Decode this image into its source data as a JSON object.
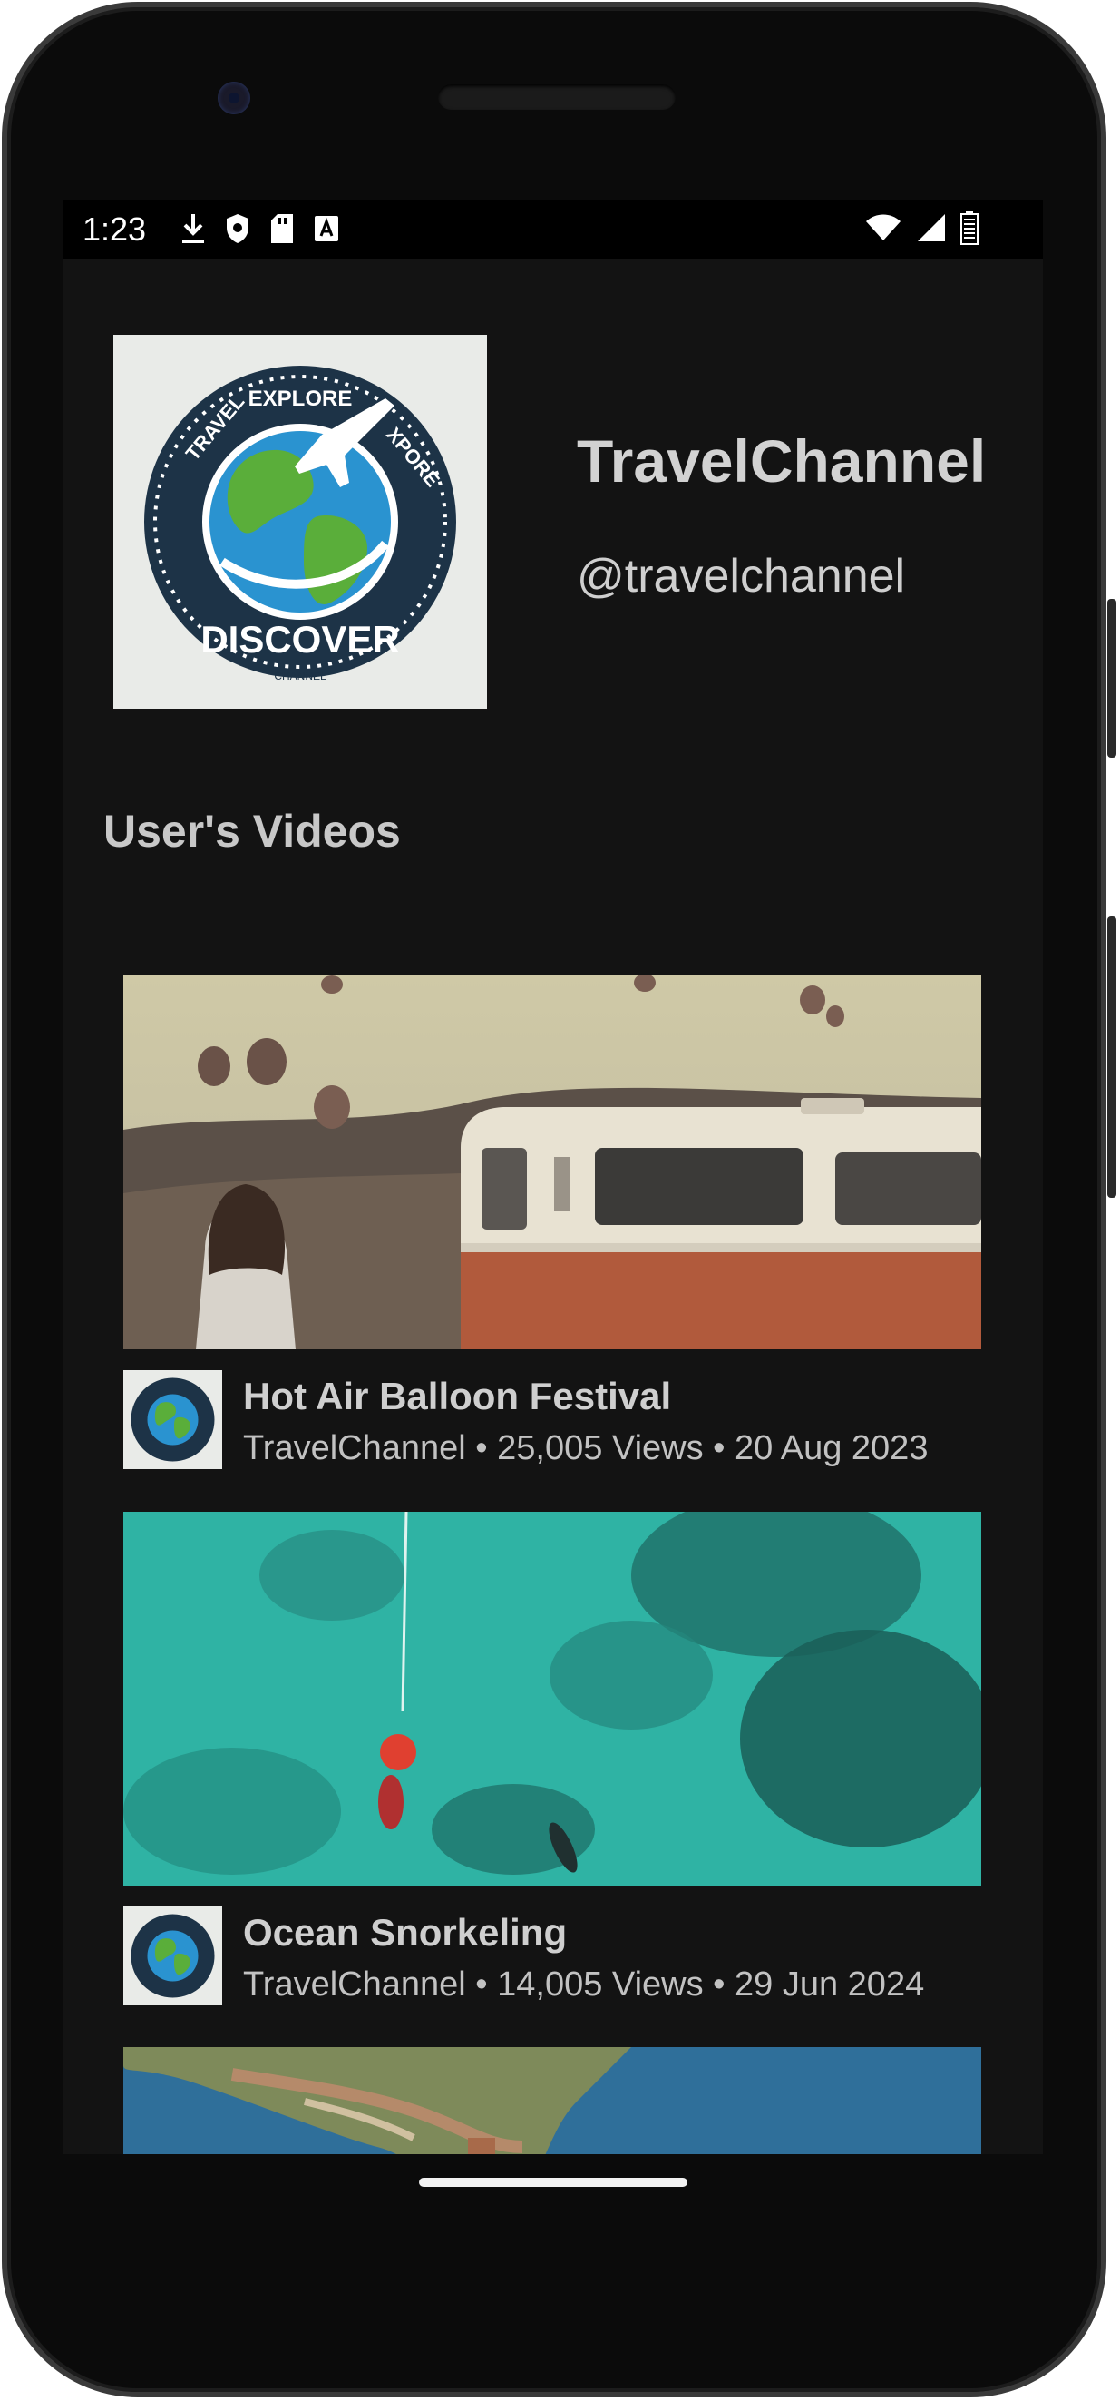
{
  "statusbar": {
    "time": "1:23",
    "left_icons": [
      "download-icon",
      "shield-icon",
      "sdcard-icon",
      "keyboard-a-icon"
    ],
    "right_icons": [
      "wifi-icon",
      "signal-icon",
      "battery-icon"
    ]
  },
  "channel": {
    "name": "TravelChannel",
    "handle": "@travelchannel",
    "logo_text": [
      "TRAVEL",
      "EXPLORE",
      "XPORE",
      "DISCOVER",
      "CHANNEL"
    ]
  },
  "section": {
    "title": "User's Videos"
  },
  "videos": [
    {
      "title": "Hot Air Balloon Festival",
      "subtitle": "TravelChannel • 25,005 Views • 20 Aug 2023",
      "thumb": "balloons-van"
    },
    {
      "title": "Ocean Snorkeling",
      "subtitle": "TravelChannel • 14,005 Views • 29 Jun 2024",
      "thumb": "ocean-aerial"
    },
    {
      "title": "",
      "subtitle": "",
      "thumb": "coast-aerial"
    }
  ],
  "colors": {
    "screen_bg": "#131313",
    "text_primary": "#d2d2d2",
    "accent_globe": "#2a93d0",
    "accent_land": "#5aae3a"
  }
}
